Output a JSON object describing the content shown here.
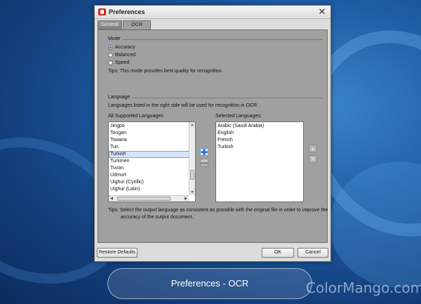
{
  "window": {
    "title": "Preferences",
    "close_glyph": "✕"
  },
  "tabs": [
    {
      "label": "General",
      "active": false
    },
    {
      "label": "OCR",
      "active": true
    }
  ],
  "mode": {
    "title": "Mode",
    "options": [
      {
        "label": "Accuracy",
        "selected": true
      },
      {
        "label": "Balanced",
        "selected": false
      },
      {
        "label": "Speed",
        "selected": false
      }
    ],
    "tip": "Tips:  This mode provides best quality for recognition."
  },
  "language": {
    "title": "Language",
    "description": "Languages listed in the right side will be used for recognition in OCR.",
    "all_label": "All Supported Languages:",
    "selected_label": "Selected Languages:",
    "all_languages": [
      "Jingpo",
      "Tongan",
      "Tswana",
      "Tun",
      "Turkish",
      "Turkmen",
      "Tuvan",
      "Udmurt",
      "Uighur (Cyrillic)",
      "Uighur (Latin)"
    ],
    "highlighted": "Turkish",
    "selected_languages": [
      "Arabic (Saudi Arabia)",
      "English",
      "French",
      "Turkish"
    ],
    "tip_line1": "Tips:  Select the output language as consistent as possible with the original file in order to improve the",
    "tip_line2": "accuracy of the output document."
  },
  "buttons": {
    "restore": "Restore Defaults",
    "ok": "OK",
    "cancel": "Cancel",
    "add_glyph": "✚",
    "remove_glyph": "▬",
    "up_glyph": "▲",
    "down_glyph": "▼"
  },
  "caption": "Preferences - OCR",
  "watermark": "ColorMango.com",
  "icons": {
    "app": "app-logo-icon",
    "close": "close-icon",
    "add": "plus-icon",
    "remove": "minus-icon",
    "up": "arrow-up-icon",
    "down": "arrow-down-icon"
  },
  "colors": {
    "accent": "#2f5fd0",
    "panel": "#a0a0a0",
    "selection": "#d6e4f7"
  }
}
